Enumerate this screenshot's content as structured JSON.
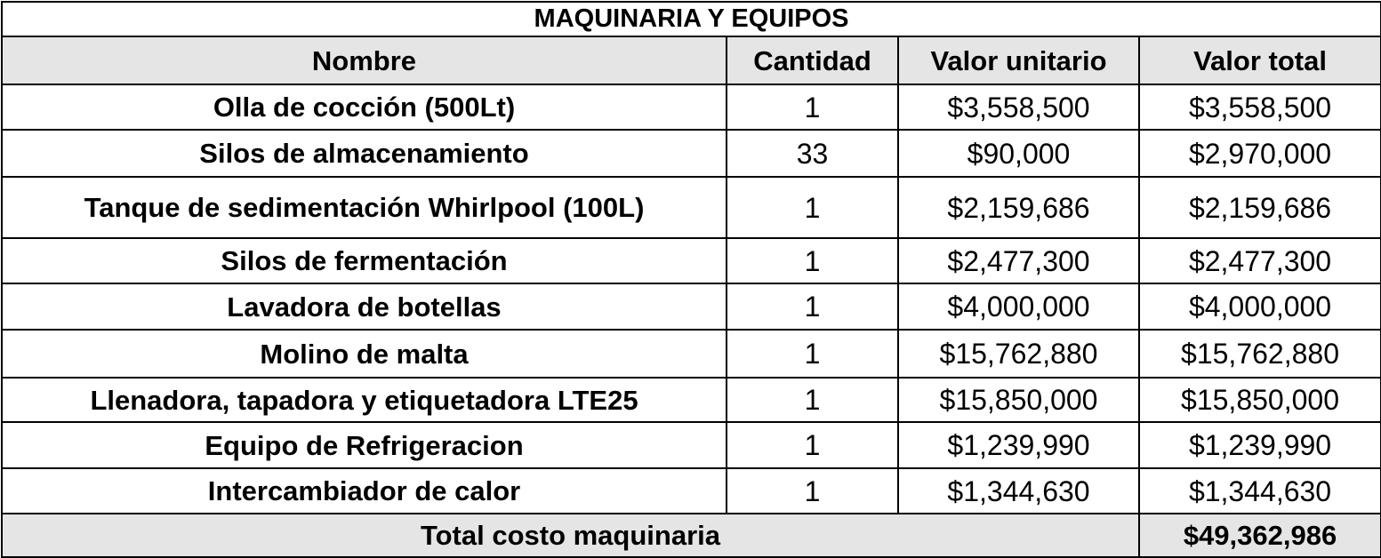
{
  "table": {
    "title": "MAQUINARIA Y EQUIPOS",
    "headers": {
      "name": "Nombre",
      "quantity": "Cantidad",
      "unit_value": "Valor unitario",
      "total_value": "Valor total"
    },
    "rows": [
      {
        "name": "Olla de cocción (500Lt)",
        "quantity": "1",
        "unit_value": "$3,558,500",
        "total_value": "$3,558,500"
      },
      {
        "name": "Silos de almacenamiento",
        "quantity": "33",
        "unit_value": "$90,000",
        "total_value": "$2,970,000"
      },
      {
        "name": "Tanque de sedimentación Whirlpool (100L)",
        "quantity": "1",
        "unit_value": "$2,159,686",
        "total_value": "$2,159,686"
      },
      {
        "name": "Silos de fermentación",
        "quantity": "1",
        "unit_value": "$2,477,300",
        "total_value": "$2,477,300"
      },
      {
        "name": "Lavadora de botellas",
        "quantity": "1",
        "unit_value": "$4,000,000",
        "total_value": "$4,000,000"
      },
      {
        "name": "Molino de malta",
        "quantity": "1",
        "unit_value": "$15,762,880",
        "total_value": "$15,762,880"
      },
      {
        "name": "Llenadora, tapadora y etiquetadora LTE25",
        "quantity": "1",
        "unit_value": "$15,850,000",
        "total_value": "$15,850,000"
      },
      {
        "name": "Equipo de Refrigeracion",
        "quantity": "1",
        "unit_value": "$1,239,990",
        "total_value": "$1,239,990"
      },
      {
        "name": "Intercambiador de calor",
        "quantity": "1",
        "unit_value": "$1,344,630",
        "total_value": "$1,344,630"
      }
    ],
    "total": {
      "label": "Total costo maquinaria",
      "value": "$49,362,986"
    }
  }
}
